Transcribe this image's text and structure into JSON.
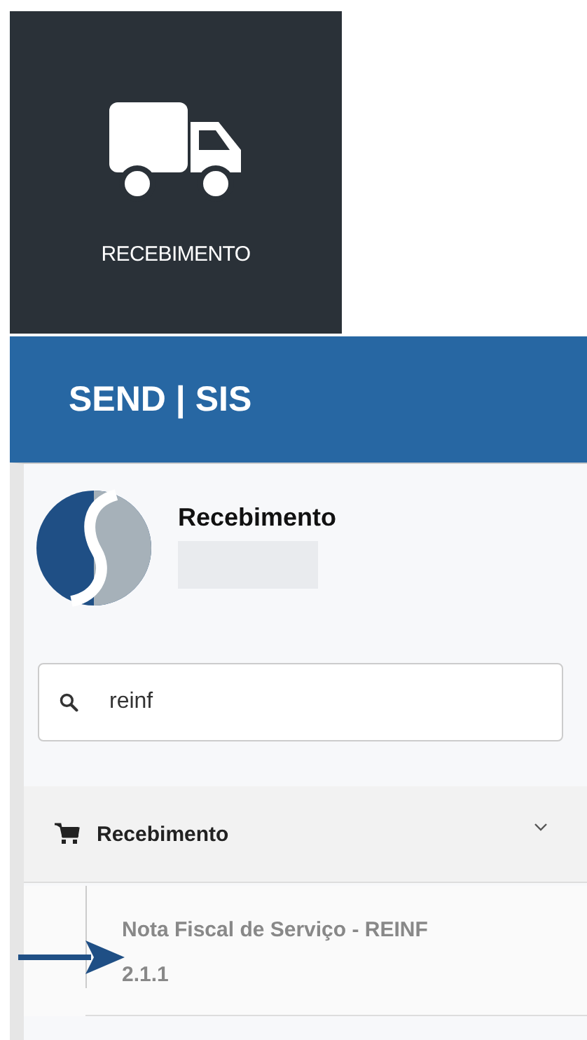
{
  "tile": {
    "label": "RECEBIMENTO"
  },
  "header": {
    "title": "SEND | SIS"
  },
  "profile": {
    "name": "Recebimento"
  },
  "search": {
    "value": "reinf"
  },
  "menu": [
    {
      "label": "Recebimento",
      "expanded": true,
      "children": [
        {
          "label": "Nota Fiscal de Serviço - REINF 2.1.1"
        }
      ]
    }
  ]
}
